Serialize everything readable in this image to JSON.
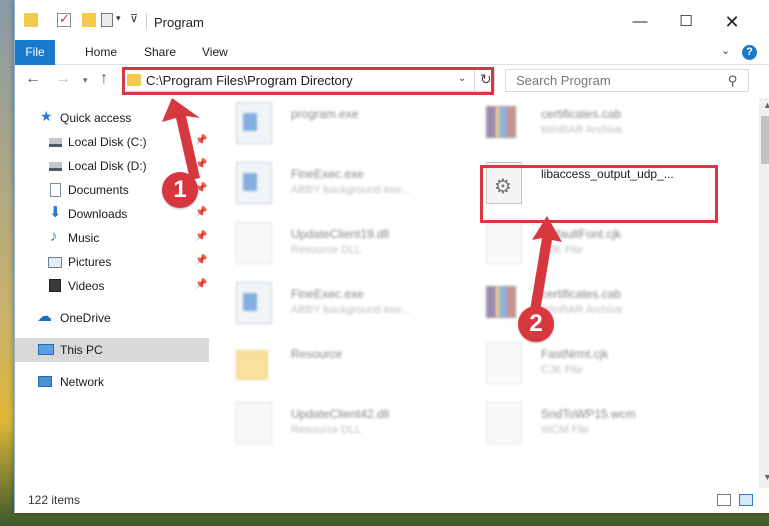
{
  "window": {
    "title": "Program",
    "minimize_glyph": "—",
    "maximize_glyph": "☐",
    "close_glyph": "✕"
  },
  "ribbon": {
    "tabs": [
      {
        "label": "File",
        "active": true
      },
      {
        "label": "Home"
      },
      {
        "label": "Share"
      },
      {
        "label": "View"
      }
    ],
    "help_glyph": "?"
  },
  "navigation": {
    "address": "C:\\Program Files\\Program Directory",
    "search_placeholder": "Search Program"
  },
  "sidebar": {
    "items": [
      {
        "label": "Quick access",
        "icon": "star-icon",
        "pinned": false
      },
      {
        "label": "Local Disk (C:)",
        "icon": "drive-icon",
        "pinned": true
      },
      {
        "label": "Local Disk (D:)",
        "icon": "drive-icon",
        "pinned": true
      },
      {
        "label": "Documents",
        "icon": "documents-icon",
        "pinned": true
      },
      {
        "label": "Downloads",
        "icon": "download-icon",
        "pinned": true
      },
      {
        "label": "Music",
        "icon": "music-icon",
        "pinned": true
      },
      {
        "label": "Pictures",
        "icon": "pictures-icon",
        "pinned": true
      },
      {
        "label": "Videos",
        "icon": "videos-icon",
        "pinned": true
      },
      {
        "label": "OneDrive",
        "icon": "cloud-icon",
        "pinned": false
      },
      {
        "label": "This PC",
        "icon": "computer-icon",
        "pinned": false,
        "selected": true
      },
      {
        "label": "Network",
        "icon": "network-icon",
        "pinned": false
      }
    ]
  },
  "files": [
    {
      "name": "program.exe",
      "type": "",
      "icon": "exe-icon"
    },
    {
      "name": "certificates.cab",
      "type": "WinRAR Archive",
      "icon": "archive-icon"
    },
    {
      "name": "FineExec.exe",
      "type": "ABBY background exe...",
      "icon": "exe-icon"
    },
    {
      "name": "libaccess_output_udp_...",
      "type": "",
      "icon": "dll-gear-icon",
      "highlighted": true
    },
    {
      "name": "UpdateClient19.dll",
      "type": "Resource DLL",
      "icon": "dll-icon"
    },
    {
      "name": "DefaultFont.cjk",
      "type": "CJK File",
      "icon": "file-icon"
    },
    {
      "name": "FineExec.exe",
      "type": "ABBY background exe...",
      "icon": "exe-icon"
    },
    {
      "name": "certificates.cab",
      "type": "WinRAR Archive",
      "icon": "archive-icon"
    },
    {
      "name": "Resource",
      "type": "",
      "icon": "folder-icon"
    },
    {
      "name": "FastNrmt.cjk",
      "type": "CJK File",
      "icon": "file-icon"
    },
    {
      "name": "UpdateClient42.dll",
      "type": "Resource DLL",
      "icon": "dll-icon"
    },
    {
      "name": "SndToWP15.wcm",
      "type": "WCM File",
      "icon": "file-icon"
    }
  ],
  "status": {
    "items_count": "122 items"
  },
  "callouts": [
    "1",
    "2"
  ],
  "colors": {
    "accent": "#1979ca",
    "highlight": "#d7373f"
  }
}
